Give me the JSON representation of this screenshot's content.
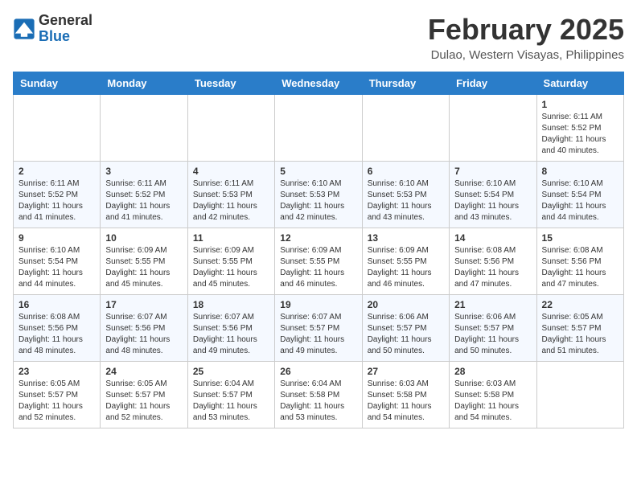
{
  "header": {
    "logo": {
      "general": "General",
      "blue": "Blue"
    },
    "title": "February 2025",
    "location": "Dulao, Western Visayas, Philippines"
  },
  "calendar": {
    "weekdays": [
      "Sunday",
      "Monday",
      "Tuesday",
      "Wednesday",
      "Thursday",
      "Friday",
      "Saturday"
    ],
    "weeks": [
      [
        {
          "day": "",
          "sunrise": "",
          "sunset": "",
          "daylight": ""
        },
        {
          "day": "",
          "sunrise": "",
          "sunset": "",
          "daylight": ""
        },
        {
          "day": "",
          "sunrise": "",
          "sunset": "",
          "daylight": ""
        },
        {
          "day": "",
          "sunrise": "",
          "sunset": "",
          "daylight": ""
        },
        {
          "day": "",
          "sunrise": "",
          "sunset": "",
          "daylight": ""
        },
        {
          "day": "",
          "sunrise": "",
          "sunset": "",
          "daylight": ""
        },
        {
          "day": "1",
          "sunrise": "Sunrise: 6:11 AM",
          "sunset": "Sunset: 5:52 PM",
          "daylight": "Daylight: 11 hours and 40 minutes."
        }
      ],
      [
        {
          "day": "2",
          "sunrise": "Sunrise: 6:11 AM",
          "sunset": "Sunset: 5:52 PM",
          "daylight": "Daylight: 11 hours and 41 minutes."
        },
        {
          "day": "3",
          "sunrise": "Sunrise: 6:11 AM",
          "sunset": "Sunset: 5:52 PM",
          "daylight": "Daylight: 11 hours and 41 minutes."
        },
        {
          "day": "4",
          "sunrise": "Sunrise: 6:11 AM",
          "sunset": "Sunset: 5:53 PM",
          "daylight": "Daylight: 11 hours and 42 minutes."
        },
        {
          "day": "5",
          "sunrise": "Sunrise: 6:10 AM",
          "sunset": "Sunset: 5:53 PM",
          "daylight": "Daylight: 11 hours and 42 minutes."
        },
        {
          "day": "6",
          "sunrise": "Sunrise: 6:10 AM",
          "sunset": "Sunset: 5:53 PM",
          "daylight": "Daylight: 11 hours and 43 minutes."
        },
        {
          "day": "7",
          "sunrise": "Sunrise: 6:10 AM",
          "sunset": "Sunset: 5:54 PM",
          "daylight": "Daylight: 11 hours and 43 minutes."
        },
        {
          "day": "8",
          "sunrise": "Sunrise: 6:10 AM",
          "sunset": "Sunset: 5:54 PM",
          "daylight": "Daylight: 11 hours and 44 minutes."
        }
      ],
      [
        {
          "day": "9",
          "sunrise": "Sunrise: 6:10 AM",
          "sunset": "Sunset: 5:54 PM",
          "daylight": "Daylight: 11 hours and 44 minutes."
        },
        {
          "day": "10",
          "sunrise": "Sunrise: 6:09 AM",
          "sunset": "Sunset: 5:55 PM",
          "daylight": "Daylight: 11 hours and 45 minutes."
        },
        {
          "day": "11",
          "sunrise": "Sunrise: 6:09 AM",
          "sunset": "Sunset: 5:55 PM",
          "daylight": "Daylight: 11 hours and 45 minutes."
        },
        {
          "day": "12",
          "sunrise": "Sunrise: 6:09 AM",
          "sunset": "Sunset: 5:55 PM",
          "daylight": "Daylight: 11 hours and 46 minutes."
        },
        {
          "day": "13",
          "sunrise": "Sunrise: 6:09 AM",
          "sunset": "Sunset: 5:55 PM",
          "daylight": "Daylight: 11 hours and 46 minutes."
        },
        {
          "day": "14",
          "sunrise": "Sunrise: 6:08 AM",
          "sunset": "Sunset: 5:56 PM",
          "daylight": "Daylight: 11 hours and 47 minutes."
        },
        {
          "day": "15",
          "sunrise": "Sunrise: 6:08 AM",
          "sunset": "Sunset: 5:56 PM",
          "daylight": "Daylight: 11 hours and 47 minutes."
        }
      ],
      [
        {
          "day": "16",
          "sunrise": "Sunrise: 6:08 AM",
          "sunset": "Sunset: 5:56 PM",
          "daylight": "Daylight: 11 hours and 48 minutes."
        },
        {
          "day": "17",
          "sunrise": "Sunrise: 6:07 AM",
          "sunset": "Sunset: 5:56 PM",
          "daylight": "Daylight: 11 hours and 48 minutes."
        },
        {
          "day": "18",
          "sunrise": "Sunrise: 6:07 AM",
          "sunset": "Sunset: 5:56 PM",
          "daylight": "Daylight: 11 hours and 49 minutes."
        },
        {
          "day": "19",
          "sunrise": "Sunrise: 6:07 AM",
          "sunset": "Sunset: 5:57 PM",
          "daylight": "Daylight: 11 hours and 49 minutes."
        },
        {
          "day": "20",
          "sunrise": "Sunrise: 6:06 AM",
          "sunset": "Sunset: 5:57 PM",
          "daylight": "Daylight: 11 hours and 50 minutes."
        },
        {
          "day": "21",
          "sunrise": "Sunrise: 6:06 AM",
          "sunset": "Sunset: 5:57 PM",
          "daylight": "Daylight: 11 hours and 50 minutes."
        },
        {
          "day": "22",
          "sunrise": "Sunrise: 6:05 AM",
          "sunset": "Sunset: 5:57 PM",
          "daylight": "Daylight: 11 hours and 51 minutes."
        }
      ],
      [
        {
          "day": "23",
          "sunrise": "Sunrise: 6:05 AM",
          "sunset": "Sunset: 5:57 PM",
          "daylight": "Daylight: 11 hours and 52 minutes."
        },
        {
          "day": "24",
          "sunrise": "Sunrise: 6:05 AM",
          "sunset": "Sunset: 5:57 PM",
          "daylight": "Daylight: 11 hours and 52 minutes."
        },
        {
          "day": "25",
          "sunrise": "Sunrise: 6:04 AM",
          "sunset": "Sunset: 5:57 PM",
          "daylight": "Daylight: 11 hours and 53 minutes."
        },
        {
          "day": "26",
          "sunrise": "Sunrise: 6:04 AM",
          "sunset": "Sunset: 5:58 PM",
          "daylight": "Daylight: 11 hours and 53 minutes."
        },
        {
          "day": "27",
          "sunrise": "Sunrise: 6:03 AM",
          "sunset": "Sunset: 5:58 PM",
          "daylight": "Daylight: 11 hours and 54 minutes."
        },
        {
          "day": "28",
          "sunrise": "Sunrise: 6:03 AM",
          "sunset": "Sunset: 5:58 PM",
          "daylight": "Daylight: 11 hours and 54 minutes."
        },
        {
          "day": "",
          "sunrise": "",
          "sunset": "",
          "daylight": ""
        }
      ]
    ]
  }
}
